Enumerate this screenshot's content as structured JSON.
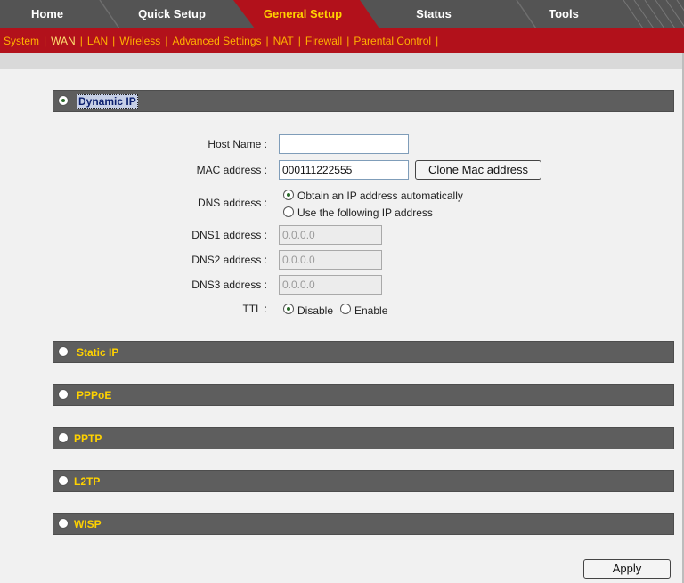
{
  "tabs": [
    {
      "label": "Home"
    },
    {
      "label": "Quick Setup"
    },
    {
      "label": "General Setup"
    },
    {
      "label": "Status"
    },
    {
      "label": "Tools"
    }
  ],
  "subnav": [
    {
      "label": "System"
    },
    {
      "label": "WAN"
    },
    {
      "label": "LAN"
    },
    {
      "label": "Wireless"
    },
    {
      "label": "Advanced Settings"
    },
    {
      "label": "NAT"
    },
    {
      "label": "Firewall"
    },
    {
      "label": "Parental Control"
    }
  ],
  "subnav_separator": "|",
  "sections": {
    "dynamic_ip": "Dynamic IP",
    "static_ip": "Static IP",
    "pppoe": "PPPoE",
    "pptp": "PPTP",
    "l2tp": "L2TP",
    "wisp": "WISP"
  },
  "form": {
    "host_name_label": "Host Name :",
    "host_name_value": "",
    "mac_label": "MAC address :",
    "mac_value": "000111222555",
    "clone_button": "Clone Mac address",
    "dns_label": "DNS address :",
    "dns_auto": "Obtain an IP address automatically",
    "dns_manual": "Use the following IP address",
    "dns1_label": "DNS1 address :",
    "dns1_value": "0.0.0.0",
    "dns2_label": "DNS2 address :",
    "dns2_value": "0.0.0.0",
    "dns3_label": "DNS3 address :",
    "dns3_value": "0.0.0.0",
    "ttl_label": "TTL :",
    "ttl_disable": "Disable",
    "ttl_enable": "Enable"
  },
  "apply_button": "Apply",
  "colors": {
    "tabbar": "#545454",
    "active_tab": "#b2111b",
    "subnav": "#b2111b",
    "subnav_text": "#ffb000",
    "section_bar": "#5e5e5e",
    "section_title": "#ffd200"
  }
}
